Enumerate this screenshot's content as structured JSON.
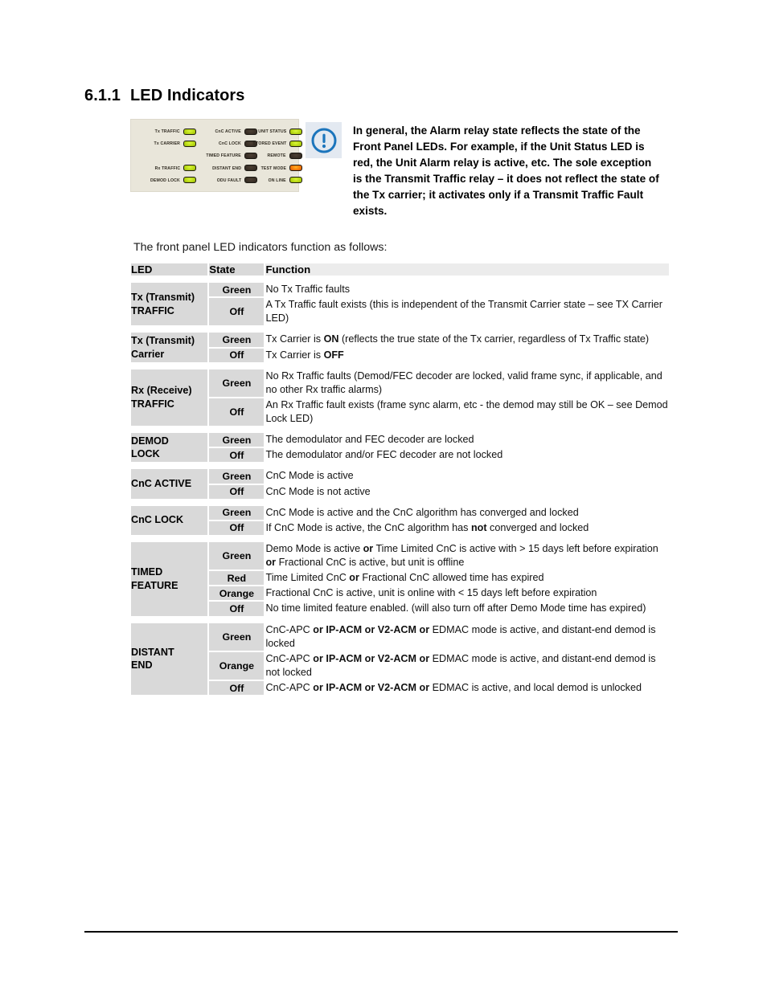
{
  "heading": {
    "number": "6.1.1",
    "title": "LED Indicators"
  },
  "callout": {
    "icon": "exclamation-circle-icon",
    "text": "In general, the Alarm relay state reflects the state of the Front Panel LEDs. For example, if the Unit Status LED is red, the Unit Alarm relay is active, etc. The sole exception is the Transmit Traffic relay – it does not reflect the state of the Tx carrier; it activates only if a Transmit Traffic Fault exists.",
    "accent_color": "#1c75bc",
    "icon_background": "#e3e9f1"
  },
  "led_panel": {
    "background_color": "#e9e6da",
    "lamp_green_color": "#c9e81f",
    "lamp_off_color": "#3a3027",
    "lamp_orange_color": "#f57a0a",
    "cells": [
      {
        "label": "Tx TRAFFIC",
        "state": "green"
      },
      {
        "label": "CnC ACTIVE",
        "state": "off"
      },
      {
        "label": "UNIT STATUS",
        "state": "green"
      },
      {
        "label": "Tx CARRIER",
        "state": "green"
      },
      {
        "label": "CnC LOCK",
        "state": "off"
      },
      {
        "label": "STORED EVENT",
        "state": "green"
      },
      {
        "label": "",
        "state": "empty"
      },
      {
        "label": "TIMED FEATURE",
        "state": "off"
      },
      {
        "label": "REMOTE",
        "state": "off"
      },
      {
        "label": "Rx TRAFFIC",
        "state": "green"
      },
      {
        "label": "DISTANT END",
        "state": "off"
      },
      {
        "label": "TEST MODE",
        "state": "orange"
      },
      {
        "label": "DEMOD LOCK",
        "state": "green"
      },
      {
        "label": "ODU FAULT",
        "state": "off"
      },
      {
        "label": "ON LINE",
        "state": "green"
      }
    ]
  },
  "intro_text": "The front panel LED indicators function as follows:",
  "table": {
    "headers": {
      "led": "LED",
      "state": "State",
      "function": "Function"
    },
    "groups": [
      {
        "led": "Tx (Transmit)\nTRAFFIC",
        "rows": [
          {
            "state": "Green",
            "function_html": "No Tx Traffic faults"
          },
          {
            "state": "Off",
            "function_html": "A Tx Traffic fault exists (this is independent of the Transmit Carrier state – see TX Carrier LED)"
          }
        ]
      },
      {
        "led": "Tx (Transmit)\nCarrier",
        "rows": [
          {
            "state": "Green",
            "function_html": "Tx Carrier is <b>ON</b> (reflects the true state of the Tx carrier, regardless of Tx Traffic state)"
          },
          {
            "state": "Off",
            "function_html": "Tx Carrier is <b>OFF</b>"
          }
        ]
      },
      {
        "led": "Rx (Receive)\nTRAFFIC",
        "rows": [
          {
            "state": "Green",
            "function_html": "No Rx Traffic faults (Demod/FEC decoder are locked, valid frame sync, if applicable, and no other Rx traffic alarms)"
          },
          {
            "state": "Off",
            "function_html": "An Rx Traffic fault exists (frame sync alarm, etc - the demod may still be OK – see Demod Lock LED)"
          }
        ]
      },
      {
        "led": "DEMOD\nLOCK",
        "rows": [
          {
            "state": "Green",
            "function_html": "The demodulator and FEC decoder are locked"
          },
          {
            "state": "Off",
            "function_html": "The demodulator and/or FEC decoder are not locked"
          }
        ]
      },
      {
        "led": "CnC ACTIVE",
        "rows": [
          {
            "state": "Green",
            "function_html": "CnC Mode is active"
          },
          {
            "state": "Off",
            "function_html": "CnC Mode is not active"
          }
        ]
      },
      {
        "led": "CnC LOCK",
        "rows": [
          {
            "state": "Green",
            "function_html": "CnC Mode is active and the CnC algorithm has converged and locked"
          },
          {
            "state": "Off",
            "function_html": "If CnC Mode is active, the CnC algorithm has <b>not</b> converged and locked"
          }
        ]
      },
      {
        "led": "TIMED\nFEATURE",
        "rows": [
          {
            "state": "Green",
            "function_html": "Demo Mode is active <b>or</b> Time Limited CnC is active with &gt; 15 days left before expiration <b>or</b> Fractional CnC is active, but unit is offline"
          },
          {
            "state": "Red",
            "function_html": "Time Limited CnC <b>or</b> Fractional CnC allowed time has expired"
          },
          {
            "state": "Orange",
            "function_html": "Fractional CnC is active, unit is online with &lt; 15 days left before expiration"
          },
          {
            "state": "Off",
            "function_html": "No time limited feature enabled. (will also turn off after Demo Mode time has expired)"
          }
        ]
      },
      {
        "led": "DISTANT\nEND",
        "rows": [
          {
            "state": "Green",
            "function_html": "CnC-APC <b>or IP-ACM or V2-ACM or</b> EDMAC mode is active, and distant-end demod is locked"
          },
          {
            "state": "Orange",
            "function_html": "CnC-APC <b>or IP-ACM or V2-ACM or</b> EDMAC mode is active, and distant-end demod is not locked"
          },
          {
            "state": "Off",
            "function_html": "CnC-APC <b>or IP-ACM or V2-ACM or</b> EDMAC is active, and local demod is unlocked"
          }
        ]
      }
    ]
  }
}
